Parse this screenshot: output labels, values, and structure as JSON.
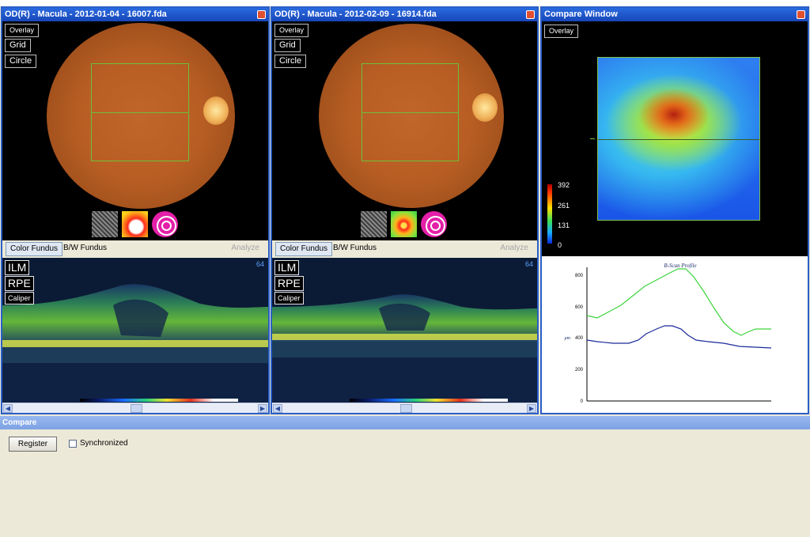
{
  "panels": [
    {
      "title": "OD(R) - Macula - 2012-01-04 - 16007.fda",
      "buttons": [
        "Overlay",
        "Grid",
        "Circle"
      ],
      "tabs": {
        "active": "Color Fundus",
        "other": "B/W Fundus",
        "analyze": "Analyze"
      },
      "oct_buttons": [
        "ILM",
        "RPE",
        "Caliper"
      ],
      "slice_number": "64"
    },
    {
      "title": "OD(R) - Macula - 2012-02-09 - 16914.fda",
      "buttons": [
        "Overlay",
        "Grid",
        "Circle"
      ],
      "tabs": {
        "active": "Color Fundus",
        "other": "B/W Fundus",
        "analyze": "Analyze"
      },
      "oct_buttons": [
        "ILM",
        "RPE",
        "Caliper"
      ],
      "slice_number": "64"
    }
  ],
  "compare_window": {
    "title": "Compare Window",
    "overlay_button": "Overlay",
    "legend": [
      "392",
      "261",
      "131",
      "0"
    ],
    "profile": {
      "title": "B-Scan Profile",
      "ylabel": "μm",
      "yticks": [
        "800",
        "600",
        "400",
        "200",
        "0"
      ]
    }
  },
  "compare_section": {
    "title": "Compare",
    "register_label": "Register",
    "synchronized_label": "Synchronized",
    "synchronized_checked": false
  },
  "colors": {
    "titlebar": "#1f5ad0",
    "panel_border": "#2a5fc7",
    "profile_green": "#3bd43b",
    "profile_blue": "#1a2a9a"
  }
}
